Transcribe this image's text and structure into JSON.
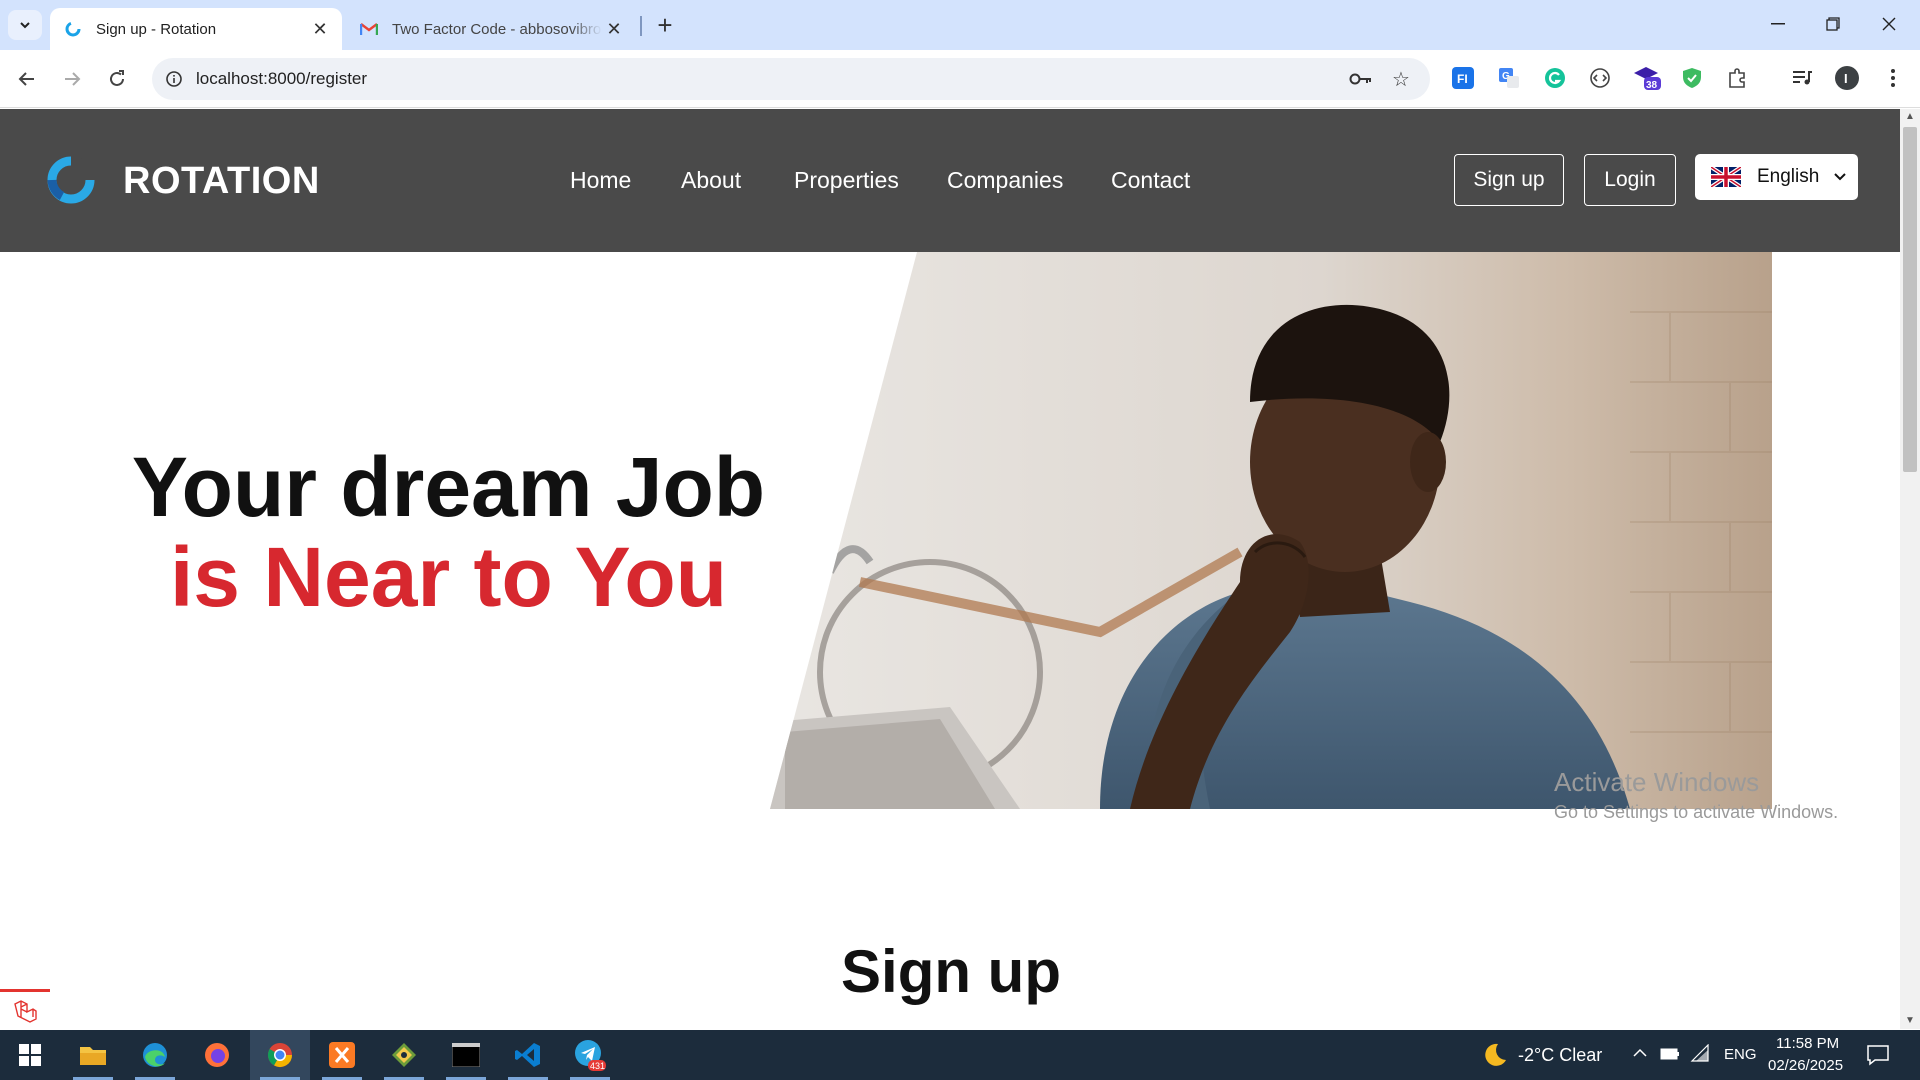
{
  "browser": {
    "tabs": [
      {
        "title": "Sign up - Rotation",
        "active": true
      },
      {
        "title": "Two Factor Code - abbosovibrohim",
        "active": false
      }
    ],
    "new_tab": "+",
    "url": "localhost:8000/register",
    "extension_badge": "38",
    "profile_initial": "I"
  },
  "site": {
    "brand": "ROTATION",
    "nav": [
      "Home",
      "About",
      "Properties",
      "Companies",
      "Contact"
    ],
    "signup_label": "Sign up",
    "login_label": "Login",
    "language": "English",
    "hero_line1": "Your dream Job",
    "hero_line2": "is Near to You",
    "section_title": "Sign up",
    "accent_color": "#d7282f",
    "nav_bg": "#4a4a4a"
  },
  "watermark": {
    "title": "Activate Windows",
    "subtitle": "Go to Settings to activate Windows."
  },
  "taskbar": {
    "weather": "-2°C  Clear",
    "lang": "ENG",
    "time": "11:58 PM",
    "date": "02/26/2025",
    "telegram_badge": "431"
  }
}
